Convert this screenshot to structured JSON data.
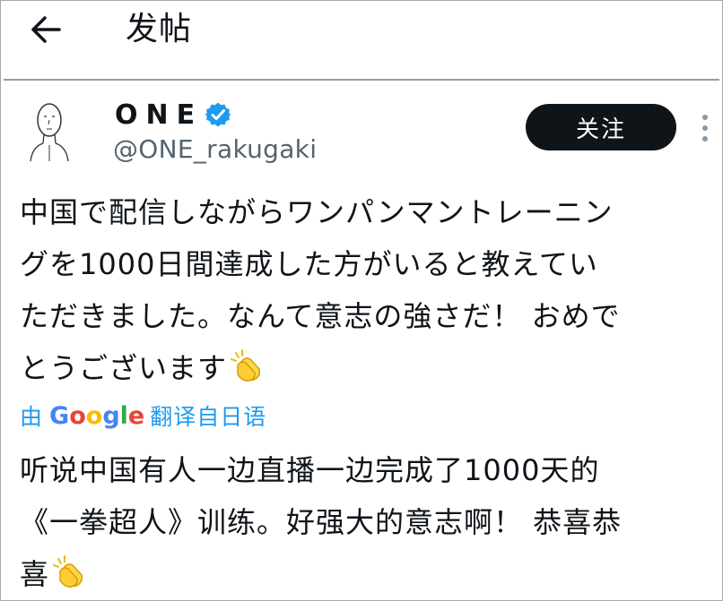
{
  "header": {
    "title": "发帖"
  },
  "author": {
    "display_name": "ONE",
    "handle": "@ONE_rakugaki",
    "verified": true
  },
  "follow_button": {
    "label": "关注"
  },
  "tweet": {
    "lines": [
      "中国で配信しながらワンパンマントレーニン",
      "グを1000日間達成した方がいると教えてい",
      "ただきました。なんて意志の強さだ！ おめで",
      "とうございます"
    ],
    "emoji": "clapping-hands"
  },
  "translation": {
    "by_label": "由",
    "provider_letters": [
      "G",
      "o",
      "o",
      "g",
      "l",
      "e"
    ],
    "action_label": "翻译自日语",
    "lines": [
      "听说中国有人一边直播一边完成了1000天的",
      "《一拳超人》训练。好强大的意志啊！ 恭喜恭",
      "喜"
    ]
  },
  "colors": {
    "text": "#0f1419",
    "secondary": "#536471",
    "link": "#1d9bf0",
    "button_bg": "#0f1419",
    "verified": "#1d9bf0"
  },
  "icons": {
    "back": "back-arrow-icon",
    "verified": "verified-badge-icon",
    "more": "more-vertical-icon",
    "emoji": "clapping-hands-icon"
  }
}
